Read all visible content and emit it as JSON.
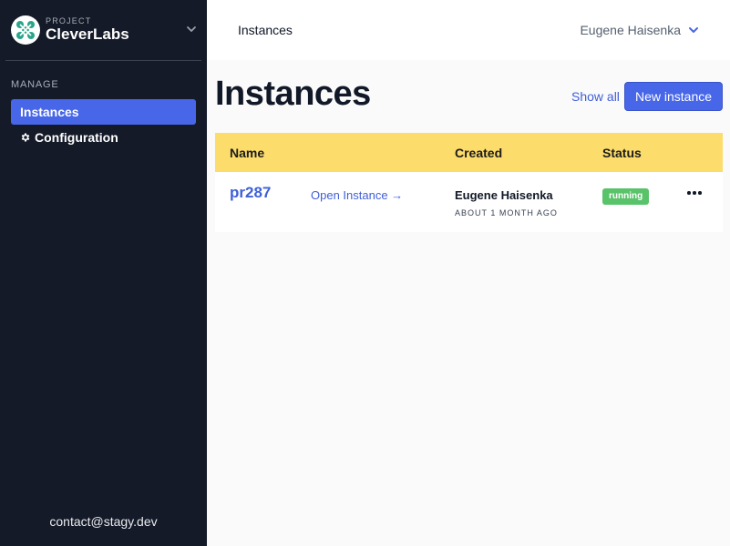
{
  "sidebar": {
    "project_kicker": "PROJECT",
    "project_name": "CleverLabs",
    "section_label": "MANAGE",
    "items": [
      {
        "label": "Instances",
        "active": true
      },
      {
        "label": "Configuration",
        "icon": "gear-icon"
      }
    ],
    "contact": "contact@stagy.dev"
  },
  "topbar": {
    "title": "Instances",
    "user_name": "Eugene Haisenka"
  },
  "main": {
    "title": "Instances",
    "show_all": "Show all",
    "new_instance": "New instance"
  },
  "table": {
    "headers": [
      "Name",
      "Created",
      "Status"
    ],
    "rows": [
      {
        "name": "pr287",
        "open_link": "Open Instance →",
        "creator": "Eugene Haisenka",
        "created_time": "ABOUT 1 MONTH AGO",
        "status": "running"
      }
    ]
  },
  "colors": {
    "accent": "#4766e8",
    "sidebar_bg": "#141a28",
    "table_header_bg": "#fcdc6a",
    "status_running": "#59c36a",
    "link": "#3f5fd8"
  }
}
